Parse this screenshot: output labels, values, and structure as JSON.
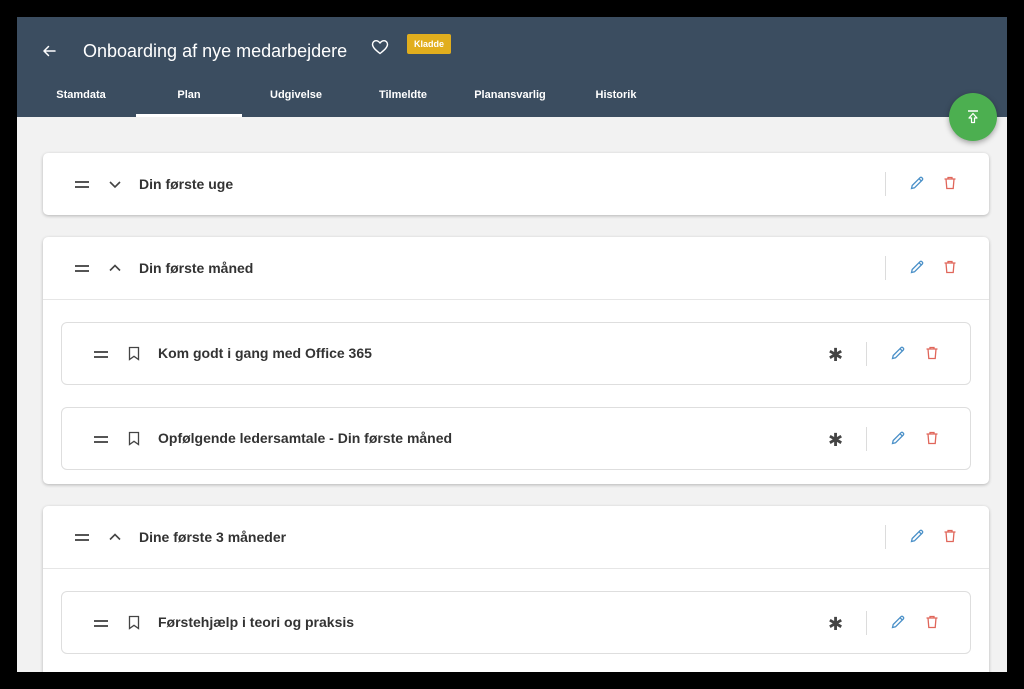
{
  "header": {
    "title": "Onboarding af nye medarbejdere",
    "badge": "Kladde",
    "back_icon": "arrow-left-icon",
    "favorite_icon": "heart-outline-icon"
  },
  "tabs": [
    {
      "label": "Stamdata",
      "active": false
    },
    {
      "label": "Plan",
      "active": true
    },
    {
      "label": "Udgivelse",
      "active": false
    },
    {
      "label": "Tilmeldte",
      "active": false
    },
    {
      "label": "Planansvarlig",
      "active": false
    },
    {
      "label": "Historik",
      "active": false
    }
  ],
  "fab": {
    "icon": "publish-upload-icon",
    "color": "#4caf50"
  },
  "colors": {
    "appbar": "#3b4d60",
    "badge": "#e1ae1d",
    "edit": "#4a90c8",
    "delete": "#e0665a"
  },
  "sections": [
    {
      "title": "Din første uge",
      "expanded": false,
      "items": []
    },
    {
      "title": "Din første måned",
      "expanded": true,
      "items": [
        {
          "title": "Kom godt i gang med Office 365"
        },
        {
          "title": "Opfølgende ledersamtale - Din første måned"
        }
      ]
    },
    {
      "title": "Dine første 3 måneder",
      "expanded": true,
      "items": [
        {
          "title": "Førstehjælp i teori og praksis"
        }
      ]
    }
  ]
}
